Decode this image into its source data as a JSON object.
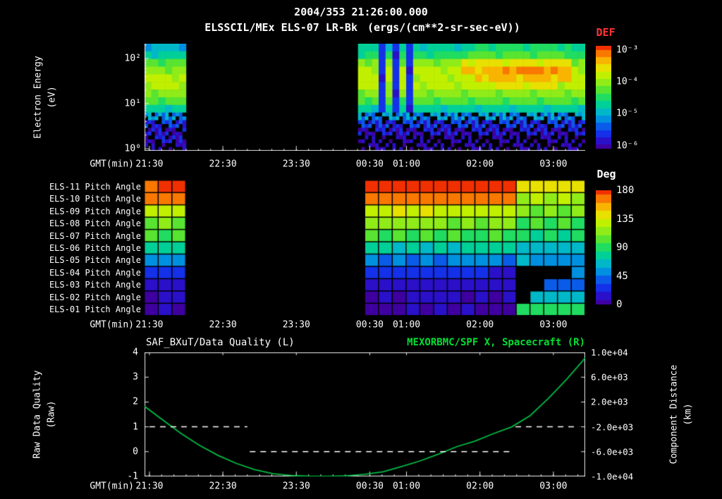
{
  "header": {
    "datetime": "2004/353 21:26:00.000",
    "instrument": "ELSSCIL/MEx ELS-07 LR-Bk",
    "units": "(ergs/(cm**2-sr-sec-eV))"
  },
  "colors": {
    "background": "#000000",
    "text": "#ffffff",
    "def_title": "#ff3333",
    "green_text": "#00e033",
    "curve_green": "#00bb44",
    "quality_line": "#ffffff"
  },
  "colormap": [
    "#000000",
    "#3f00a0",
    "#2a10c8",
    "#1430e8",
    "#0a5ce8",
    "#0090e0",
    "#00b8c8",
    "#00d098",
    "#20dc60",
    "#58e430",
    "#90ec18",
    "#c0f000",
    "#e8e000",
    "#f8b400",
    "#f87800",
    "#f03000"
  ],
  "time_axis": {
    "label": "GMT(min)",
    "start_gmt": "21:26",
    "span_minutes": 360,
    "ticks": [
      {
        "label": "21:30",
        "t": 4
      },
      {
        "label": "22:30",
        "t": 64
      },
      {
        "label": "23:30",
        "t": 124
      },
      {
        "label": "00:30",
        "t": 184
      },
      {
        "label": "01:00",
        "t": 214
      },
      {
        "label": "02:00",
        "t": 274
      },
      {
        "label": "03:00",
        "t": 334
      }
    ]
  },
  "chart_data": [
    {
      "type": "heatmap",
      "name": "electron-energy-spectrogram",
      "ylabel_lines": [
        "Electron Energy",
        "(eV)"
      ],
      "y_scale": "log",
      "y_ticks": [
        {
          "label": "10²",
          "frac": 0.138
        },
        {
          "label": "10¹",
          "frac": 0.559
        },
        {
          "label": "10⁰",
          "frac": 0.98
        }
      ],
      "colorbar": {
        "title": "DEF",
        "tick_labels": [
          "10⁻³",
          "10⁻⁴",
          "10⁻⁵",
          "10⁻⁶"
        ],
        "tick_fracs": [
          0.04,
          0.35,
          0.66,
          0.97
        ]
      },
      "cols": 64,
      "data_gaps_cols": [
        [
          6,
          31
        ]
      ],
      "speckle_rows": [
        9,
        10,
        11,
        12,
        13
      ],
      "stripes": {
        "cols": [
          34,
          36,
          38
        ],
        "row_range": [
          0,
          9
        ],
        "value": 3
      },
      "rows": [
        {
          "energy_ev": 200,
          "runs": [
            [
              0,
              6,
              6
            ],
            [
              31,
              64,
              7
            ],
            [
              48,
              62,
              8
            ]
          ]
        },
        {
          "energy_ev": 130,
          "runs": [
            [
              0,
              6,
              7
            ],
            [
              31,
              64,
              8
            ],
            [
              46,
              62,
              9
            ]
          ]
        },
        {
          "energy_ev": 85,
          "runs": [
            [
              0,
              6,
              9
            ],
            [
              31,
              64,
              10
            ],
            [
              46,
              62,
              12
            ]
          ]
        },
        {
          "energy_ev": 55,
          "runs": [
            [
              0,
              6,
              10
            ],
            [
              31,
              64,
              11
            ],
            [
              46,
              62,
              13
            ],
            [
              52,
              60,
              14
            ]
          ]
        },
        {
          "energy_ev": 35,
          "runs": [
            [
              0,
              6,
              11
            ],
            [
              31,
              64,
              11
            ],
            [
              48,
              62,
              13
            ]
          ]
        },
        {
          "energy_ev": 22,
          "runs": [
            [
              0,
              6,
              11
            ],
            [
              31,
              64,
              11
            ],
            [
              50,
              60,
              12
            ]
          ]
        },
        {
          "energy_ev": 14,
          "runs": [
            [
              0,
              6,
              10
            ],
            [
              31,
              64,
              10
            ]
          ]
        },
        {
          "energy_ev": 9,
          "runs": [
            [
              0,
              6,
              9
            ],
            [
              31,
              64,
              9
            ]
          ]
        },
        {
          "energy_ev": 6,
          "runs": [
            [
              0,
              6,
              7
            ],
            [
              31,
              64,
              7
            ]
          ]
        },
        {
          "energy_ev": 4,
          "runs": [
            [
              0,
              6,
              5
            ],
            [
              31,
              64,
              5
            ]
          ]
        },
        {
          "energy_ev": 2.6,
          "runs": [
            [
              0,
              6,
              3
            ],
            [
              31,
              64,
              3
            ]
          ]
        },
        {
          "energy_ev": 1.8,
          "runs": [
            [
              0,
              6,
              2
            ],
            [
              31,
              64,
              2
            ]
          ]
        },
        {
          "energy_ev": 1.4,
          "runs": [
            [
              0,
              6,
              2
            ],
            [
              31,
              64,
              1
            ]
          ]
        },
        {
          "energy_ev": 1.0,
          "runs": [
            [
              0,
              6,
              1
            ],
            [
              31,
              64,
              1
            ]
          ]
        }
      ]
    },
    {
      "type": "heatmap",
      "name": "pitch-angle-panel",
      "unit": "deg",
      "cols": 32,
      "colorbar": {
        "title": "Deg",
        "tick_labels": [
          "180",
          "135",
          "90",
          "45",
          "0"
        ],
        "tick_values": [
          180,
          135,
          90,
          45,
          0
        ]
      },
      "rows": [
        {
          "label": "ELS-11 Pitch Angle",
          "runs": [
            [
              0,
              3,
              176
            ],
            [
              16,
              27,
              178
            ],
            [
              27,
              32,
              140
            ]
          ]
        },
        {
          "label": "ELS-10 Pitch Angle",
          "runs": [
            [
              0,
              3,
              162
            ],
            [
              16,
              27,
              168
            ],
            [
              27,
              32,
              122
            ]
          ]
        },
        {
          "label": "ELS-09 Pitch Angle",
          "runs": [
            [
              0,
              3,
              128
            ],
            [
              16,
              27,
              132
            ],
            [
              27,
              32,
              108
            ]
          ]
        },
        {
          "label": "ELS-08 Pitch Angle",
          "runs": [
            [
              0,
              3,
              110
            ],
            [
              16,
              27,
              112
            ],
            [
              27,
              32,
              96
            ]
          ]
        },
        {
          "label": "ELS-07 Pitch Angle",
          "runs": [
            [
              0,
              3,
              95
            ],
            [
              16,
              27,
              96
            ],
            [
              27,
              32,
              84
            ]
          ]
        },
        {
          "label": "ELS-06 Pitch Angle",
          "runs": [
            [
              0,
              3,
              75
            ],
            [
              16,
              27,
              72
            ],
            [
              27,
              32,
              64
            ]
          ]
        },
        {
          "label": "ELS-05 Pitch Angle",
          "runs": [
            [
              0,
              3,
              50
            ],
            [
              16,
              27,
              46
            ],
            [
              27,
              32,
              56
            ]
          ]
        },
        {
          "label": "ELS-04 Pitch Angle",
          "runs": [
            [
              0,
              3,
              30
            ],
            [
              16,
              25,
              26
            ],
            [
              25,
              27,
              12
            ],
            [
              27,
              31,
              -1
            ],
            [
              31,
              32,
              45
            ]
          ]
        },
        {
          "label": "ELS-03 Pitch Angle",
          "runs": [
            [
              0,
              3,
              18
            ],
            [
              16,
              27,
              14
            ],
            [
              27,
              29,
              -1
            ],
            [
              29,
              32,
              36
            ]
          ]
        },
        {
          "label": "ELS-02 Pitch Angle",
          "runs": [
            [
              0,
              3,
              10
            ],
            [
              16,
              27,
              8
            ],
            [
              27,
              28,
              -1
            ],
            [
              28,
              32,
              66
            ]
          ]
        },
        {
          "label": "ELS-01 Pitch Angle",
          "runs": [
            [
              0,
              3,
              4
            ],
            [
              16,
              27,
              5
            ],
            [
              27,
              32,
              92
            ]
          ]
        }
      ]
    },
    {
      "type": "line",
      "name": "quality-and-position",
      "title_left": "SAF_BXuT/Data Quality (L)",
      "title_right": "MEXORBMC/SPF X, Spacecraft (R)",
      "left_axis": {
        "label_lines": [
          "Raw Data Quality",
          "(Raw)"
        ],
        "ticks": [
          "4",
          "3",
          "2",
          "1",
          "0",
          "-1"
        ],
        "min": -1,
        "max": 4
      },
      "right_axis": {
        "label_lines": [
          "Component Distance",
          "(km)"
        ],
        "ticks": [
          "1.0e+04",
          "6.0e+03",
          "2.0e+03",
          "-2.0e+03",
          "-6.0e+03",
          "-1.0e+04"
        ],
        "min": -10000,
        "max": 10000
      },
      "quality_segments": [
        {
          "t": [
            4,
            84
          ],
          "value": 1
        },
        {
          "t": [
            86,
            301
          ],
          "value": 0
        },
        {
          "t": [
            303,
            355
          ],
          "value": 1
        }
      ],
      "position_series": {
        "t": [
          0,
          15,
          30,
          45,
          60,
          75,
          90,
          105,
          120,
          135,
          150,
          165,
          180,
          195,
          210,
          225,
          240,
          255,
          270,
          285,
          300,
          315,
          330,
          345,
          360
        ],
        "x_km": [
          1300,
          -900,
          -3100,
          -5000,
          -6600,
          -7900,
          -8900,
          -9550,
          -9850,
          -9970,
          -9990,
          -9900,
          -9650,
          -9250,
          -8400,
          -7500,
          -6400,
          -5200,
          -4300,
          -3100,
          -2000,
          -200,
          2600,
          5700,
          9100
        ]
      }
    }
  ]
}
